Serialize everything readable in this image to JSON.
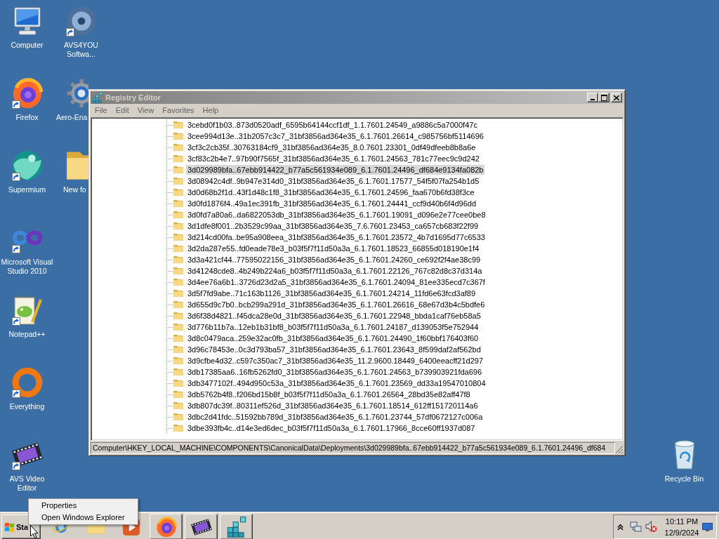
{
  "desktop": {
    "icon_columns": [
      {
        "icons": [
          {
            "label": "Computer",
            "kind": "computer",
            "shortcut": false
          },
          {
            "label": "Firefox",
            "kind": "firefox",
            "shortcut": true
          },
          {
            "label": "Supermium",
            "kind": "supermium",
            "shortcut": true
          },
          {
            "label": "Microsoft Visual Studio 2010",
            "kind": "visual-studio",
            "shortcut": true
          },
          {
            "label": "Notepad++",
            "kind": "notepad",
            "shortcut": true
          },
          {
            "label": "Everything",
            "kind": "everything",
            "shortcut": true
          },
          {
            "label": "AVS Video Editor",
            "kind": "video-editor",
            "shortcut": true
          }
        ]
      },
      {
        "icons": [
          {
            "label": "AVS4YOU Softwa...",
            "kind": "avs4you",
            "shortcut": true
          },
          {
            "label": "Aero-Ena",
            "kind": "gear",
            "shortcut": false
          },
          {
            "label": "New fo",
            "kind": "folder",
            "shortcut": false
          }
        ]
      }
    ],
    "recycle_bin": {
      "label": "Recycle Bin",
      "kind": "recycle-bin",
      "shortcut": false
    }
  },
  "window": {
    "title": "Registry Editor",
    "active": false,
    "menu": [
      "File",
      "Edit",
      "View",
      "Favorites",
      "Help"
    ],
    "tree": {
      "rows": [
        {
          "name": "3cebd0f1b03..873d0520adf_6595b64144ccf1df_1.1.7601.24549_a9886c5a7000f47c",
          "selected": false
        },
        {
          "name": "3cee994d13e..31b2057c3c7_31bf3856ad364e35_6.1.7601.26614_c985756bf5114696",
          "selected": false
        },
        {
          "name": "3cf3c2cb35f..30763184cf9_31bf3856ad364e35_8.0.7601.23301_0df49dfeeb8b8a6e",
          "selected": false
        },
        {
          "name": "3cf83c2b4e7..97b90f7565f_31bf3856ad364e35_6.1.7601.24563_781c77eec9c9d242",
          "selected": false
        },
        {
          "name": "3d029989bfa..67ebb914422_b77a5c561934e089_6.1.7601.24496_df684e9134fa082b",
          "selected": true
        },
        {
          "name": "3d08942c4df..9b947e314d0_31bf3856ad364e35_6.1.7601.17577_54f5f07fa254b1d5",
          "selected": false
        },
        {
          "name": "3d0d68b2f1d..43f1d48c1f8_31bf3856ad364e35_6.1.7601.24596_faa670b6fd38f3ce",
          "selected": false
        },
        {
          "name": "3d0fd1876f4..49a1ec391fb_31bf3856ad364e35_6.1.7601.24441_ccf9d40b6f4d96dd",
          "selected": false
        },
        {
          "name": "3d0fd7a80a6..da6822053db_31bf3856ad364e35_6.1.7601.19091_d096e2e77cee0be8",
          "selected": false
        },
        {
          "name": "3d1dfe8f001..2b3529c99aa_31bf3856ad364e35_7.6.7601.23453_ca657cb683f22f99",
          "selected": false
        },
        {
          "name": "3d214cd00fa..be95a908eea_31bf3856ad364e35_6.1.7601.23572_4b7d1695d77c6533",
          "selected": false
        },
        {
          "name": "3d2da287e55..fd0eade78e3_b03f5f7f11d50a3a_6.1.7601.18523_66855d018190e1f4",
          "selected": false
        },
        {
          "name": "3d3a421cf44..77595022156_31bf3856ad364e35_6.1.7601.24260_ce692f2f4ae38c99",
          "selected": false
        },
        {
          "name": "3d41248cde8..4b249b224a6_b03f5f7f11d50a3a_6.1.7601.22126_767c82d8c37d314a",
          "selected": false
        },
        {
          "name": "3d4ee76a6b1..3726d23d2a5_31bf3856ad364e35_6.1.7601.24094_81ee335ecd7c367f",
          "selected": false
        },
        {
          "name": "3d5f7fd9abe..71c163b1126_31bf3856ad364e35_6.1.7601.24214_11fd6e63fcd3af89",
          "selected": false
        },
        {
          "name": "3d655d9c7b0..bcb299a291d_31bf3856ad364e35_6.1.7601.26616_68e67d3b4c5bdfe6",
          "selected": false
        },
        {
          "name": "3d6f38d4821..f45dca28e0d_31bf3856ad364e35_6.1.7601.22948_bbda1caf76eb58a5",
          "selected": false
        },
        {
          "name": "3d776b11b7a..12eb1b31bf8_b03f5f7f11d50a3a_6.1.7601.24187_d139053f5e752944",
          "selected": false
        },
        {
          "name": "3d8c0479aca..259e32ac0fb_31bf3856ad364e35_6.1.7601.24490_1f60bbf176403f60",
          "selected": false
        },
        {
          "name": "3d96c78453e..0c3d793ba57_31bf3856ad364e35_6.1.7601.23643_8f599daf2af562bd",
          "selected": false
        },
        {
          "name": "3d9cfbe4d32..c597c350ac7_31bf3856ad364e35_11.2.9600.18449_6400eeacff21d297",
          "selected": false
        },
        {
          "name": "3db17385aa6..16fb5262fd0_31bf3856ad364e35_6.1.7601.24563_b739903921fda696",
          "selected": false
        },
        {
          "name": "3db3477102f..494d950c53a_31bf3856ad364e35_6.1.7601.23569_dd33a19547010804",
          "selected": false
        },
        {
          "name": "3db5762b4f8..f206bd15b8f_b03f5f7f11d50a3a_6.1.7601.26564_28bd35e82aff47f8",
          "selected": false
        },
        {
          "name": "3db807dc39f..80311ef526d_31bf3856ad364e35_6.1.7601.18514_612ff151720114a6",
          "selected": false
        },
        {
          "name": "3dbc2d41fdc..51592bb789d_31bf3856ad364e35_6.1.7601.23744_57df0672127c006a",
          "selected": false
        },
        {
          "name": "3dbe393fb4c..d14e3ed6dec_b03f5f7f11d50a3a_6.1.7601.17966_8cce60ff1937d087",
          "selected": false
        }
      ]
    },
    "status_bar": "Computer\\HKEY_LOCAL_MACHINE\\COMPONENTS\\CanonicalData\\Deployments\\3d029989bfa..67ebb914422_b77a5c561934e089_6.1.7601.24496_df684"
  },
  "context_menu": {
    "items": [
      "Properties",
      "Open Windows Explorer"
    ]
  },
  "taskbar": {
    "start_button": {
      "label": "Sta"
    },
    "quick_launch": [
      {
        "kind": "globe"
      },
      {
        "kind": "folder"
      },
      {
        "kind": "media"
      }
    ],
    "window_buttons": [
      {
        "kind": "firefox"
      },
      {
        "kind": "video-editor"
      },
      {
        "kind": "registry"
      }
    ],
    "tray": {
      "volume_muted": true,
      "time": "10:11 PM",
      "date": "12/9/2024"
    }
  }
}
